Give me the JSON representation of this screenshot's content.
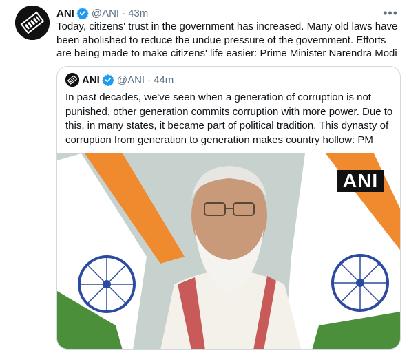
{
  "tweet": {
    "author_name": "ANI",
    "handle": "@ANI",
    "separator": "·",
    "time": "43m",
    "more_label": "•••",
    "text": "Today, citizens' trust in the government has increased. Many old laws have been abolished to reduce the undue pressure of the government. Efforts are being made to make citizens' life easier: Prime Minister Narendra Modi"
  },
  "quoted_tweet": {
    "author_name": "ANI",
    "handle": "@ANI",
    "separator": "·",
    "time": "44m",
    "text": "In past decades, we've seen when a generation of corruption is not punished, other generation commits corruption with more power. Due to this, in many states, it became part of political tradition. This dynasty of corruption from generation to generation makes country hollow: PM",
    "media_watermark": "ANI"
  },
  "colors": {
    "verified": "#1d9bf0",
    "secondary_text": "#5b7083",
    "border": "#cfd9de",
    "saffron": "#f08a2e",
    "green": "#4b8f3a",
    "chakra": "#2b4aa0"
  },
  "icons": {
    "avatar": "ani-logo-icon",
    "verified": "verified-badge-icon",
    "more": "more-options-icon"
  }
}
